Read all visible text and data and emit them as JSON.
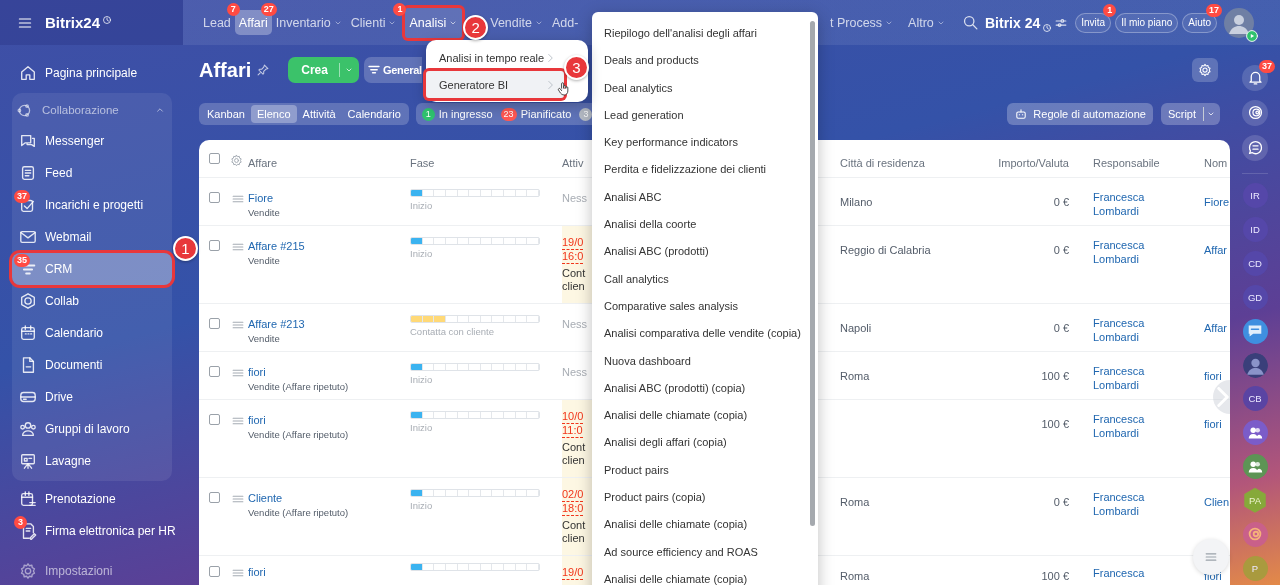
{
  "header": {
    "brand": "Bitrix24",
    "nav": [
      {
        "label": "Lead",
        "badge": "7",
        "caret": false,
        "selected": false
      },
      {
        "label": "Affari",
        "badge": "27",
        "caret": false,
        "selected": true
      },
      {
        "label": "Inventario",
        "caret": true,
        "selected": false
      },
      {
        "label": "Clienti",
        "badge": "1",
        "caret": true,
        "selected": false
      },
      {
        "label": "Analisi",
        "caret": true,
        "selected": false,
        "callout": "2"
      },
      {
        "label": "Vendite",
        "caret": true,
        "selected": false
      },
      {
        "label": "Add-",
        "caret": false,
        "selected": false
      }
    ],
    "nav_more": [
      {
        "label": "t Process",
        "caret": true,
        "selected": false
      },
      {
        "label": "Altro",
        "caret": true,
        "selected": false
      }
    ],
    "portal": "Bitrix 24",
    "buttons": [
      {
        "label": "Invita",
        "badge": "1"
      },
      {
        "label": "Il mio piano"
      },
      {
        "label": "Aiuto",
        "badge": "17"
      }
    ],
    "avatar": {
      "online": true
    }
  },
  "sidebar": {
    "items": [
      {
        "label": "Pagina principale",
        "selected": false
      },
      {
        "kind": "group",
        "label": "Collaborazione",
        "expanded": true,
        "children": [
          {
            "label": "Messenger",
            "selected": false
          },
          {
            "label": "Feed",
            "selected": false
          },
          {
            "label": "Incarichi e progetti",
            "badge": "37",
            "selected": false
          },
          {
            "label": "Webmail",
            "selected": false
          },
          {
            "label": "CRM",
            "badge": "35",
            "selected": true,
            "callout": "1"
          },
          {
            "label": "Collab",
            "selected": false
          },
          {
            "label": "Calendario",
            "selected": false
          },
          {
            "label": "Documenti",
            "selected": false
          },
          {
            "label": "Drive",
            "selected": false
          },
          {
            "label": "Gruppi di lavoro",
            "selected": false
          },
          {
            "label": "Lavagne",
            "selected": false
          }
        ]
      },
      {
        "label": "Prenotazione",
        "selected": false
      },
      {
        "label": "Firma elettronica per HR",
        "badge": "3",
        "selected": false
      }
    ],
    "settings": {
      "label": "Impostazioni"
    }
  },
  "page": {
    "title": "Affari",
    "create_button": "Crea",
    "filter": "General",
    "views": [
      {
        "label": "Kanban",
        "selected": false
      },
      {
        "label": "Elenco",
        "selected": true
      },
      {
        "label": "Attività",
        "selected": false
      },
      {
        "label": "Calendario",
        "selected": false
      }
    ],
    "counters": [
      {
        "count": "1",
        "label": "In ingresso",
        "color": "#2fc26e"
      },
      {
        "count": "23",
        "label": "Pianificato",
        "color": "#ff5752"
      },
      {
        "count": "3",
        "color": "#b6bcc6"
      }
    ],
    "automation_button": "Regole di automazione",
    "script_button": "Script"
  },
  "table": {
    "select_all": {
      "checked": false
    },
    "columns": [
      "Affare",
      "Fase",
      "Attiv",
      "Città di residenza",
      "Importo/Valuta",
      "Responsabile",
      "Nom"
    ],
    "rows": [
      {
        "checked": false,
        "title": "Fiore",
        "subtitle": "Vendite",
        "stage": {
          "label": "Inizio",
          "level": 0.09,
          "color": "#3bb3f0"
        },
        "activity": {
          "kind": "none",
          "text": "Ness"
        },
        "city": "Milano",
        "amount": "0 €",
        "owner": "Francesca Lombardi",
        "name": "Fiore"
      },
      {
        "checked": false,
        "title": "Affare #215",
        "subtitle": "Vendite",
        "stage": {
          "label": "Inizio",
          "level": 0.09,
          "color": "#3bb3f0"
        },
        "activity": {
          "kind": "todo",
          "date": "19/0",
          "time": "16:0",
          "note": "Cont clien"
        },
        "city": "Reggio di Calabria",
        "amount": "0 €",
        "owner": "Francesca Lombardi",
        "name": "Affar"
      },
      {
        "checked": false,
        "title": "Affare #213",
        "subtitle": "Vendite",
        "stage": {
          "label": "Contatta con cliente",
          "level": 0.27,
          "color": "#ffd977"
        },
        "activity": {
          "kind": "none",
          "text": "Ness"
        },
        "city": "Napoli",
        "amount": "0 €",
        "owner": "Francesca Lombardi",
        "name": "Affar"
      },
      {
        "checked": false,
        "title": "fiori",
        "subtitle": "Vendite (Affare ripetuto)",
        "stage": {
          "label": "Inizio",
          "level": 0.09,
          "color": "#3bb3f0"
        },
        "activity": {
          "kind": "none",
          "text": "Ness"
        },
        "city": "Roma",
        "amount": "100 €",
        "owner": "Francesca Lombardi",
        "name": "fiori"
      },
      {
        "checked": false,
        "title": "fiori",
        "subtitle": "Vendite (Affare ripetuto)",
        "stage": {
          "label": "Inizio",
          "level": 0.09,
          "color": "#3bb3f0"
        },
        "activity": {
          "kind": "todo",
          "date": "10/0",
          "time": "11:0",
          "note": "Cont clien"
        },
        "amount": "100 €",
        "owner": "Francesca Lombardi",
        "name": "fiori"
      },
      {
        "checked": false,
        "title": "Cliente",
        "subtitle": "Vendite (Affare ripetuto)",
        "stage": {
          "label": "Inizio",
          "level": 0.09,
          "color": "#3bb3f0"
        },
        "activity": {
          "kind": "todo",
          "date": "02/0",
          "time": "18:0",
          "note": "Cont clien"
        },
        "city": "Roma",
        "amount": "0 €",
        "owner": "Francesca Lombardi",
        "name": "Clien"
      },
      {
        "checked": false,
        "title": "fiori",
        "stage": {
          "level": 0.09,
          "color": "#3bb3f0"
        },
        "activity": {
          "kind": "todo",
          "date": "19/0"
        },
        "city": "Roma",
        "amount": "100 €",
        "owner": "Francesca",
        "name": "fiori"
      }
    ]
  },
  "submenu": {
    "items": [
      {
        "label": "Analisi in tempo reale",
        "selected": false
      },
      {
        "label": "Generatore BI",
        "selected": true,
        "callout": "3"
      }
    ]
  },
  "analytics_menu": {
    "items": [
      "Riepilogo dell'analisi degli affari",
      "Deals and products",
      "Deal analytics",
      "Lead generation",
      "Key performance indicators",
      "Perdita e fidelizzazione dei clienti",
      "Analisi ABC",
      "Analisi della coorte",
      "Analisi ABC (prodotti)",
      "Call analytics",
      "Comparative sales analysis",
      "Analisi comparativa delle vendite (copia)",
      "Nuova dashboard",
      "Analisi ABC (prodotti) (copia)",
      "Analisi delle chiamate (copia)",
      "Analisi degli affari (copia)",
      "Product pairs",
      "Product pairs (copia)",
      "Analisi delle chiamate (copia)",
      "Ad source efficiency and ROAS",
      "Analisi delle chiamate (copia)"
    ]
  },
  "rail": {
    "tools": [
      {
        "kind": "bell",
        "badge": "37"
      },
      {
        "kind": "spiral"
      },
      {
        "kind": "chat"
      }
    ],
    "contacts": [
      {
        "kind": "initials",
        "text": "IR",
        "color": "#5547a9"
      },
      {
        "kind": "initials",
        "text": "ID",
        "color": "#5547a9"
      },
      {
        "kind": "initials",
        "text": "CD",
        "color": "#5547a9"
      },
      {
        "kind": "initials",
        "text": "GD",
        "color": "#5547a9"
      },
      {
        "kind": "chat",
        "color": "#3f8fe0"
      },
      {
        "kind": "photo"
      },
      {
        "kind": "initials",
        "text": "CB",
        "color": "#5a44a3"
      },
      {
        "kind": "group",
        "color": "#7b5cc9"
      },
      {
        "kind": "group",
        "color": "#5d9455"
      },
      {
        "kind": "hexagon",
        "text": "PA",
        "color": "#86a93a"
      },
      {
        "kind": "spiral",
        "color": "#c9608a"
      },
      {
        "kind": "initials",
        "text": "P",
        "color": "#a99a3e"
      }
    ]
  }
}
